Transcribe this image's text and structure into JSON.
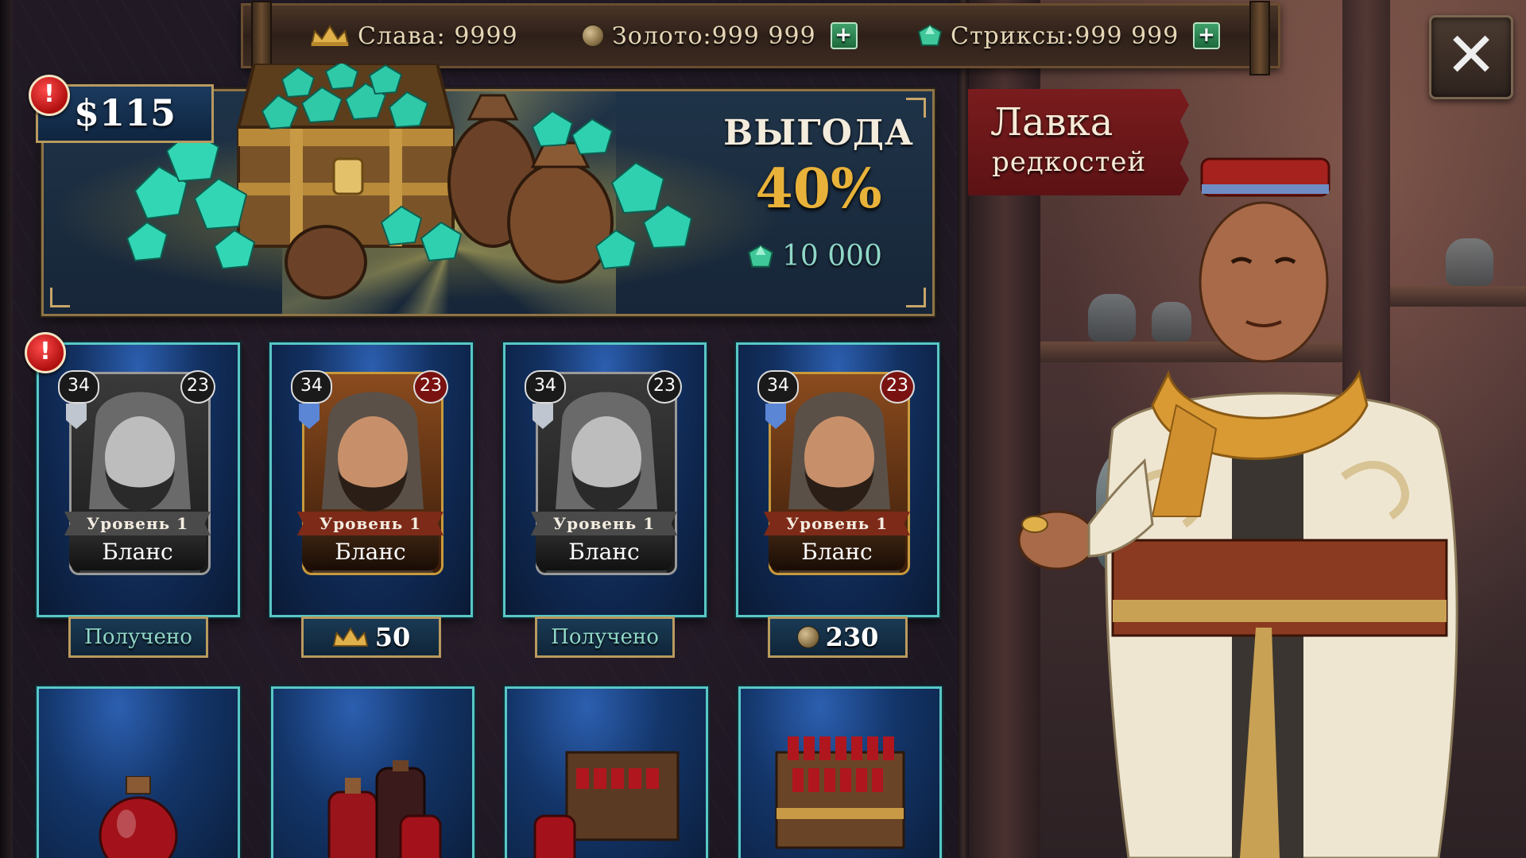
{
  "topbar": {
    "fame_label": "Слава: 9999",
    "gold_label": "Золото:999 999",
    "strix_label": "Стриксы:999 999",
    "plus": "+"
  },
  "close": {
    "label": "✕"
  },
  "offer": {
    "price": "$115",
    "alert": "!",
    "title": "ВЫГОДА",
    "percent": "40%",
    "amount": "10 000"
  },
  "shop": {
    "title_line1": "Лавка",
    "title_line2": "редкостей"
  },
  "cards": [
    {
      "attack": "34",
      "hp": "23",
      "level": "Уровень 1",
      "name": "Бланс",
      "footer": "Получено",
      "style": "grey",
      "footer_type": "received"
    },
    {
      "attack": "34",
      "hp": "23",
      "level": "Уровень 1",
      "name": "Бланс",
      "footer": "50",
      "style": "gold",
      "footer_type": "fame"
    },
    {
      "attack": "34",
      "hp": "23",
      "level": "Уровень 1",
      "name": "Бланс",
      "footer": "Получено",
      "style": "grey",
      "footer_type": "received"
    },
    {
      "attack": "34",
      "hp": "23",
      "level": "Уровень 1",
      "name": "Бланс",
      "footer": "230",
      "style": "gold",
      "footer_type": "gold"
    }
  ],
  "cards_alert": "!",
  "items": [
    {
      "icon": "potion-single-icon"
    },
    {
      "icon": "potion-set-icon"
    },
    {
      "icon": "potion-crate-icon"
    },
    {
      "icon": "potion-chest-icon"
    }
  ],
  "colors": {
    "accent_teal": "#59c7c5",
    "gold_text": "#e8b23a",
    "sign_red": "#7a1c1e"
  }
}
